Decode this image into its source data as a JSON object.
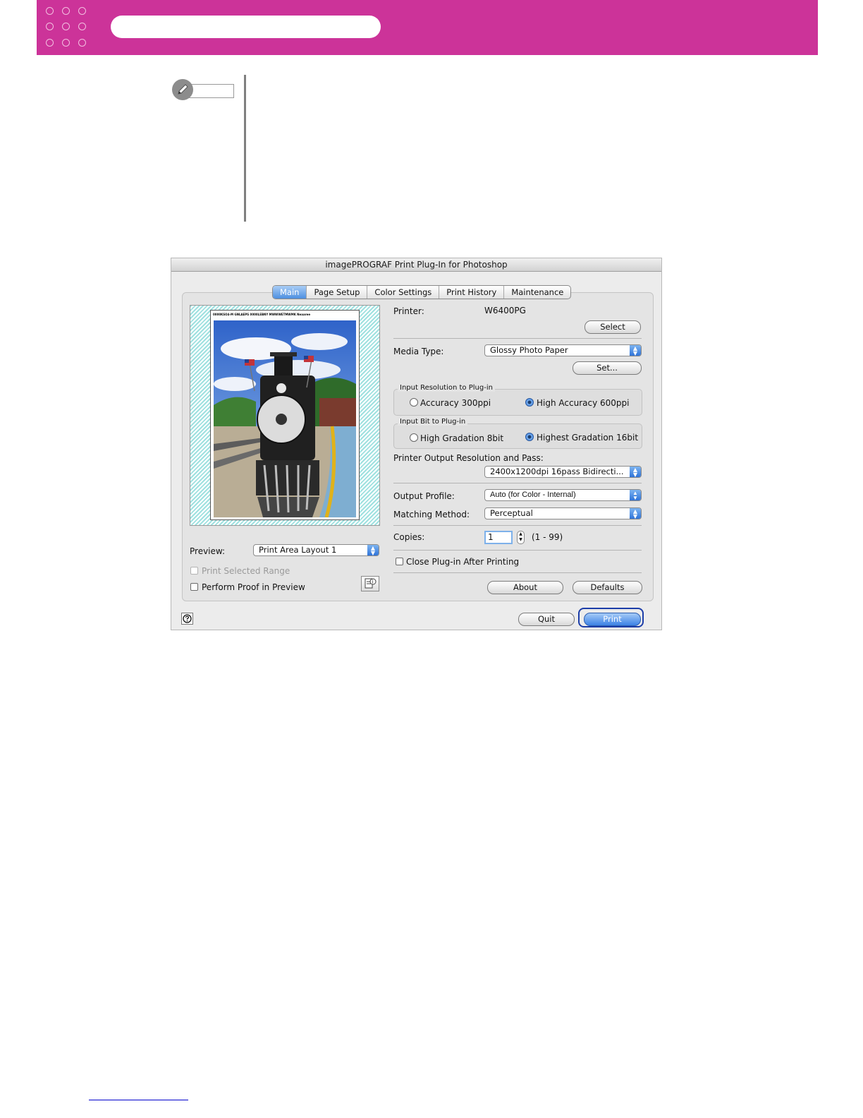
{
  "dialog": {
    "title": "imagePROGRAF Print Plug-In for Photoshop",
    "tabs": [
      {
        "label": "Main",
        "active": true
      },
      {
        "label": "Page Setup",
        "active": false
      },
      {
        "label": "Color Settings",
        "active": false
      },
      {
        "label": "Print History",
        "active": false
      },
      {
        "label": "Maintenance",
        "active": false
      }
    ],
    "preview_caption": "0000KSO4-M  GNLAEPS 0000LEBNY MWWWETMWMK Neaaree",
    "printer_label": "Printer:",
    "printer_value": "W6400PG",
    "select_button": "Select",
    "media_type_label": "Media Type:",
    "media_type_value": "Glossy Photo Paper",
    "set_button": "Set...",
    "input_resolution": {
      "title": "Input Resolution to Plug-in",
      "option1": "Accuracy 300ppi",
      "option2": "High Accuracy 600ppi",
      "selected": "High Accuracy 600ppi"
    },
    "input_bit": {
      "title": "Input Bit to Plug-in",
      "option1": "High Gradation 8bit",
      "option2": "Highest Gradation 16bit",
      "selected": "Highest Gradation 16bit"
    },
    "output_resolution_label": "Printer Output Resolution and Pass:",
    "output_resolution_value": "2400x1200dpi 16pass Bidirecti...",
    "output_profile_label": "Output Profile:",
    "output_profile_value": "Auto (for Color - Internal)",
    "matching_method_label": "Matching Method:",
    "matching_method_value": "Perceptual",
    "copies_label": "Copies:",
    "copies_value": "1",
    "copies_range": "(1 - 99)",
    "close_after_printing_label": "Close Plug-in After Printing",
    "about_button": "About",
    "defaults_button": "Defaults",
    "preview_label": "Preview:",
    "preview_value": "Print Area Layout 1",
    "print_selected_range_label": "Print Selected Range",
    "perform_proof_label": "Perform Proof in Preview",
    "quit_button": "Quit",
    "print_button": "Print"
  },
  "colors": {
    "header_magenta": "#cc3399",
    "focus_blue": "#1c3da8",
    "accent_blue": "#3c82e6",
    "preview_hatch": "#9fe1e0"
  },
  "icons": {
    "note": "pencil-icon",
    "help": "help-icon",
    "proof": "proof-info-icon",
    "popup": "up-down-arrows-icon"
  }
}
